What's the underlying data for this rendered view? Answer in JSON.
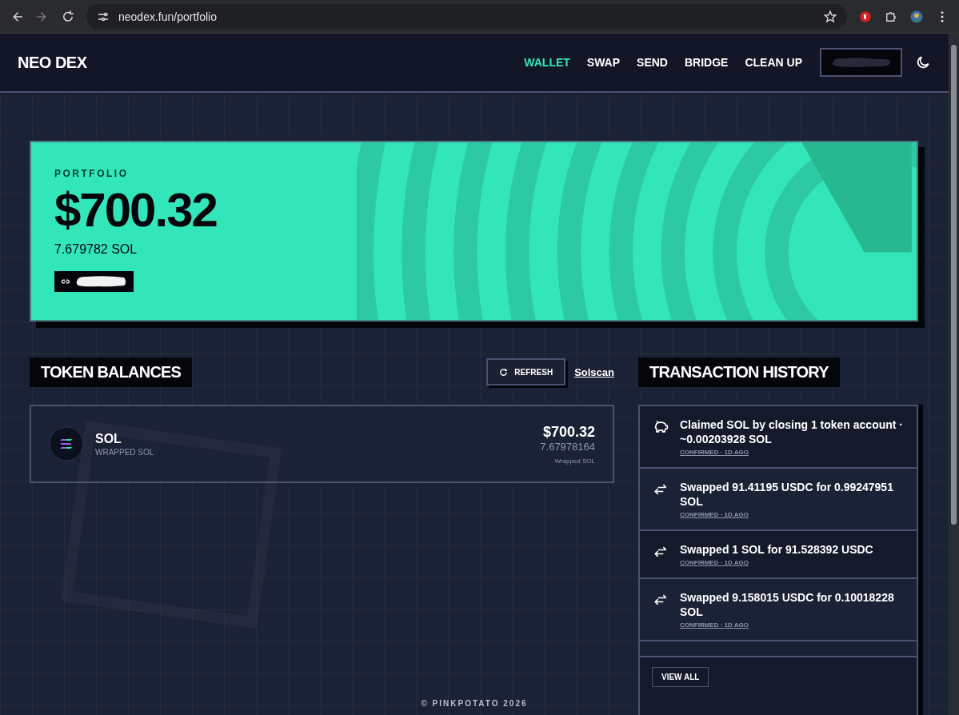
{
  "browser": {
    "address": "neodex.fun/portfolio"
  },
  "nav": {
    "logo": "NEO DEX",
    "items": [
      {
        "label": "WALLET",
        "selected": true
      },
      {
        "label": "SWAP",
        "selected": false
      },
      {
        "label": "SEND",
        "selected": false
      },
      {
        "label": "BRIDGE",
        "selected": false
      },
      {
        "label": "CLEAN UP",
        "selected": false
      }
    ]
  },
  "portfolio": {
    "label": "PORTFOLIO",
    "value": "$700.32",
    "sol": "7.679782 SOL"
  },
  "tokens": {
    "title": "TOKEN BALANCES",
    "refresh": "REFRESH",
    "link": "Solscan",
    "items": [
      {
        "symbol": "SOL",
        "name": "WRAPPED SOL",
        "usd": "$700.32",
        "amount": "7.67978164",
        "note": "Wrapped SOL"
      }
    ]
  },
  "history": {
    "title": "TRANSACTION HISTORY",
    "view_all": "VIEW ALL",
    "items": [
      {
        "kind": "claim",
        "text": "Claimed SOL by closing 1 token account · ~0.00203928 SOL",
        "status": "CONFIRMED · 1D AGO"
      },
      {
        "kind": "swap",
        "text": "Swapped 91.41195 USDC for 0.99247951 SOL",
        "status": "CONFIRMED · 1D AGO"
      },
      {
        "kind": "swap",
        "text": "Swapped 1 SOL for 91.528392 USDC",
        "status": "CONFIRMED · 1D AGO"
      },
      {
        "kind": "swap",
        "text": "Swapped 9.158015 USDC for 0.10018228 SOL",
        "status": "CONFIRMED · 1D AGO"
      }
    ]
  },
  "footer": "© PINKPOTATO 2026"
}
